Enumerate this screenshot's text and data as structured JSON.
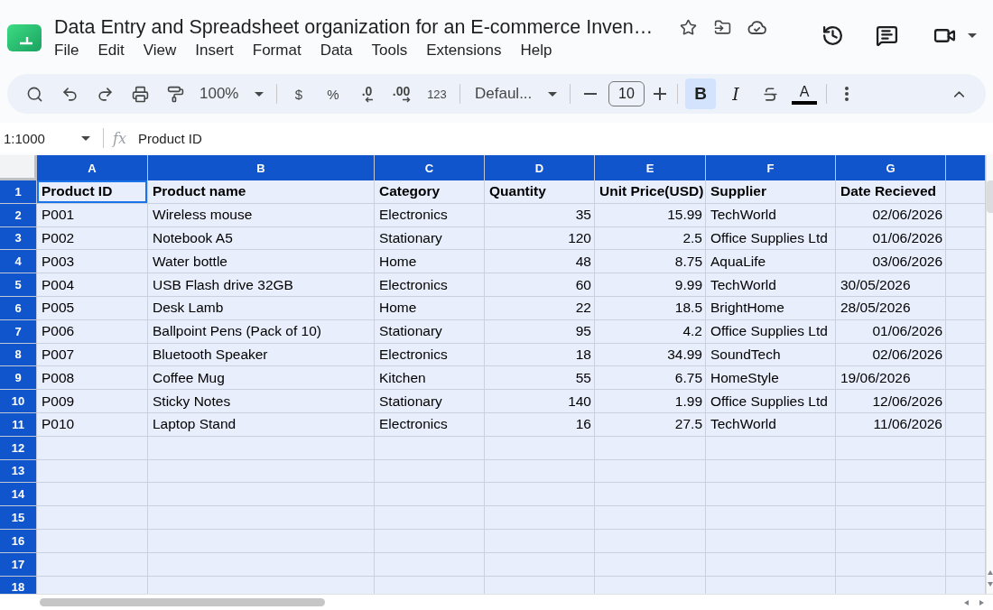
{
  "document": {
    "title": "Data Entry and Spreadsheet organization for an E-commerce Inven…"
  },
  "menu": [
    "File",
    "Edit",
    "View",
    "Insert",
    "Format",
    "Data",
    "Tools",
    "Extensions",
    "Help"
  ],
  "toolbar": {
    "zoom": "100%",
    "currency": "$",
    "percent": "%",
    "decrease_decimal": ".0",
    "increase_decimal": ".00",
    "more_formats": "123",
    "font": "Defaul...",
    "font_size": "10",
    "bold": {
      "label": "B",
      "on": true
    },
    "italic": {
      "label": "I",
      "on": false
    },
    "strikethrough": {
      "on": false
    },
    "text_color": {
      "label": "A"
    }
  },
  "formula_bar": {
    "name_box": "1:1000",
    "function_label": "fx",
    "value": "Product ID"
  },
  "sheet": {
    "columns": [
      {
        "letter": "A",
        "selected": true
      },
      {
        "letter": "B",
        "selected": true
      },
      {
        "letter": "C",
        "selected": true
      },
      {
        "letter": "D",
        "selected": true
      },
      {
        "letter": "E",
        "selected": true
      },
      {
        "letter": "F",
        "selected": true
      },
      {
        "letter": "G",
        "selected": true
      }
    ],
    "rows": [
      {
        "number": "1",
        "kind": "header",
        "selected": true,
        "cells": [
          {
            "text": "Product ID",
            "kind": "text",
            "active": true
          },
          {
            "text": "Product name",
            "kind": "text",
            "active": false
          },
          {
            "text": "Category",
            "kind": "text",
            "active": false
          },
          {
            "text": "Quantity",
            "kind": "text",
            "active": false
          },
          {
            "text": "Unit Price(USD)",
            "kind": "text",
            "active": false
          },
          {
            "text": "Supplier",
            "kind": "text",
            "active": false
          },
          {
            "text": "Date Recieved",
            "kind": "text",
            "active": false
          }
        ]
      },
      {
        "number": "2",
        "kind": "data",
        "selected": true,
        "cells": [
          {
            "text": "P001",
            "kind": "text",
            "active": false
          },
          {
            "text": "Wireless mouse",
            "kind": "text",
            "active": false
          },
          {
            "text": "Electronics",
            "kind": "text",
            "active": false
          },
          {
            "text": "35",
            "kind": "number",
            "active": false
          },
          {
            "text": "15.99",
            "kind": "number",
            "active": false
          },
          {
            "text": "TechWorld",
            "kind": "text",
            "active": false
          },
          {
            "text": "02/06/2026",
            "kind": "date",
            "active": false
          }
        ]
      },
      {
        "number": "3",
        "kind": "data",
        "selected": true,
        "cells": [
          {
            "text": "P002",
            "kind": "text",
            "active": false
          },
          {
            "text": "Notebook A5",
            "kind": "text",
            "active": false
          },
          {
            "text": "Stationary",
            "kind": "text",
            "active": false
          },
          {
            "text": "120",
            "kind": "number",
            "active": false
          },
          {
            "text": "2.5",
            "kind": "number",
            "active": false
          },
          {
            "text": "Office Supplies Ltd",
            "kind": "text",
            "active": false
          },
          {
            "text": "01/06/2026",
            "kind": "date",
            "active": false
          }
        ]
      },
      {
        "number": "4",
        "kind": "data",
        "selected": true,
        "cells": [
          {
            "text": "P003",
            "kind": "text",
            "active": false
          },
          {
            "text": "Water bottle",
            "kind": "text",
            "active": false
          },
          {
            "text": "Home",
            "kind": "text",
            "active": false
          },
          {
            "text": "48",
            "kind": "number",
            "active": false
          },
          {
            "text": "8.75",
            "kind": "number",
            "active": false
          },
          {
            "text": "AquaLife",
            "kind": "text",
            "active": false
          },
          {
            "text": "03/06/2026",
            "kind": "date",
            "active": false
          }
        ]
      },
      {
        "number": "5",
        "kind": "data",
        "selected": true,
        "cells": [
          {
            "text": "P004",
            "kind": "text",
            "active": false
          },
          {
            "text": "USB Flash drive 32GB",
            "kind": "text",
            "active": false
          },
          {
            "text": "Electronics",
            "kind": "text",
            "active": false
          },
          {
            "text": "60",
            "kind": "number",
            "active": false
          },
          {
            "text": "9.99",
            "kind": "number",
            "active": false
          },
          {
            "text": "TechWorld",
            "kind": "text",
            "active": false
          },
          {
            "text": "30/05/2026",
            "kind": "text",
            "active": false
          }
        ]
      },
      {
        "number": "6",
        "kind": "data",
        "selected": true,
        "cells": [
          {
            "text": "P005",
            "kind": "text",
            "active": false
          },
          {
            "text": "Desk Lamb",
            "kind": "text",
            "active": false
          },
          {
            "text": "Home",
            "kind": "text",
            "active": false
          },
          {
            "text": "22",
            "kind": "number",
            "active": false
          },
          {
            "text": "18.5",
            "kind": "number",
            "active": false
          },
          {
            "text": "BrightHome",
            "kind": "text",
            "active": false
          },
          {
            "text": "28/05/2026",
            "kind": "text",
            "active": false
          }
        ]
      },
      {
        "number": "7",
        "kind": "data",
        "selected": true,
        "cells": [
          {
            "text": "P006",
            "kind": "text",
            "active": false
          },
          {
            "text": "Ballpoint Pens (Pack of 10)",
            "kind": "text",
            "active": false
          },
          {
            "text": "Stationary",
            "kind": "text",
            "active": false
          },
          {
            "text": "95",
            "kind": "number",
            "active": false
          },
          {
            "text": "4.2",
            "kind": "number",
            "active": false
          },
          {
            "text": "Office Supplies Ltd",
            "kind": "text",
            "active": false
          },
          {
            "text": "01/06/2026",
            "kind": "date",
            "active": false
          }
        ]
      },
      {
        "number": "8",
        "kind": "data",
        "selected": true,
        "cells": [
          {
            "text": "P007",
            "kind": "text",
            "active": false
          },
          {
            "text": "Bluetooth Speaker",
            "kind": "text",
            "active": false
          },
          {
            "text": "Electronics",
            "kind": "text",
            "active": false
          },
          {
            "text": "18",
            "kind": "number",
            "active": false
          },
          {
            "text": "34.99",
            "kind": "number",
            "active": false
          },
          {
            "text": "SoundTech",
            "kind": "text",
            "active": false
          },
          {
            "text": "02/06/2026",
            "kind": "date",
            "active": false
          }
        ]
      },
      {
        "number": "9",
        "kind": "data",
        "selected": true,
        "cells": [
          {
            "text": "P008",
            "kind": "text",
            "active": false
          },
          {
            "text": "Coffee Mug",
            "kind": "text",
            "active": false
          },
          {
            "text": "Kitchen",
            "kind": "text",
            "active": false
          },
          {
            "text": "55",
            "kind": "number",
            "active": false
          },
          {
            "text": "6.75",
            "kind": "number",
            "active": false
          },
          {
            "text": "HomeStyle",
            "kind": "text",
            "active": false
          },
          {
            "text": "19/06/2026",
            "kind": "text",
            "active": false
          }
        ]
      },
      {
        "number": "10",
        "kind": "data",
        "selected": true,
        "cells": [
          {
            "text": "P009",
            "kind": "text",
            "active": false
          },
          {
            "text": "Sticky Notes",
            "kind": "text",
            "active": false
          },
          {
            "text": "Stationary",
            "kind": "text",
            "active": false
          },
          {
            "text": "140",
            "kind": "number",
            "active": false
          },
          {
            "text": "1.99",
            "kind": "number",
            "active": false
          },
          {
            "text": "Office Supplies Ltd",
            "kind": "text",
            "active": false
          },
          {
            "text": "12/06/2026",
            "kind": "date",
            "active": false
          }
        ]
      },
      {
        "number": "11",
        "kind": "data",
        "selected": true,
        "cells": [
          {
            "text": "P010",
            "kind": "text",
            "active": false
          },
          {
            "text": "Laptop Stand",
            "kind": "text",
            "active": false
          },
          {
            "text": "Electronics",
            "kind": "text",
            "active": false
          },
          {
            "text": "16",
            "kind": "number",
            "active": false
          },
          {
            "text": "27.5",
            "kind": "number",
            "active": false
          },
          {
            "text": "TechWorld",
            "kind": "text",
            "active": false
          },
          {
            "text": "11/06/2026",
            "kind": "date",
            "active": false
          }
        ]
      },
      {
        "number": "12",
        "kind": "data",
        "selected": true
      },
      {
        "number": "13",
        "kind": "data",
        "selected": true
      },
      {
        "number": "14",
        "kind": "data",
        "selected": true
      },
      {
        "number": "15",
        "kind": "data",
        "selected": true
      },
      {
        "number": "16",
        "kind": "data",
        "selected": true
      },
      {
        "number": "17",
        "kind": "data",
        "selected": true
      },
      {
        "number": "18",
        "kind": "data",
        "selected": true
      }
    ]
  }
}
